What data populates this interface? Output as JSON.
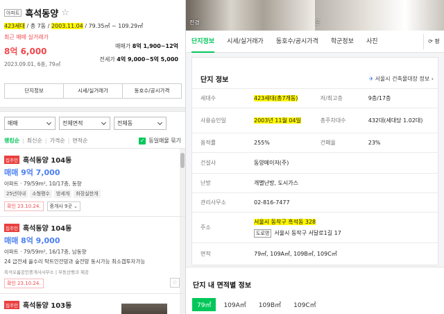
{
  "listing_header": {
    "badge": "아파트",
    "name": "흑석동양",
    "star": "☆",
    "units": "423세대",
    "floors": "총 7동",
    "built": "2003.11.04",
    "area": "79.35㎡ ~ 109.29㎡",
    "recent_label": "최근 매매 실거래가",
    "recent_price": "8억 6,000",
    "recent_date": "2023.09.01, 6층, 79㎡",
    "sale_label": "매매가",
    "sale_range": "8억 1,900~12억",
    "jeonse_label": "전세가",
    "jeonse_range": "4억 9,000~5억 5,000"
  },
  "action_buttons": [
    "단지정보",
    "시세/실거래가",
    "동호수/공시가격"
  ],
  "filters": [
    "매매",
    "전체면적",
    "전체동"
  ],
  "sort": {
    "options": [
      "랭킹순",
      "최신순",
      "가격순",
      "면적순"
    ],
    "same_listing": "동일매물 묶기"
  },
  "listings": [
    {
      "badge": "집주인",
      "name": "흑석동양 104동",
      "price": "매매 9억 7,000",
      "spec": "아파트 · 79/59m², 10/17층, 동향",
      "tags": [
        "25년이내",
        "소형평수",
        "방세개",
        "화장실한개"
      ],
      "confirm": "확인 23.10.24.",
      "brokers": "중개사 9곳 ⌄"
    },
    {
      "badge": "집주인",
      "name": "흑석동양 104동",
      "price": "매매 8억 9,000",
      "spec": "아파트 · 79/59m², 16/17층, 남동향",
      "context": "24 급전세 올수리 탁트인전망과 숲전망 동시가능 최소갭투자가능",
      "agent": "흑석오름공인중개사사무소 | 부동산뱅크 제공",
      "confirm": "확인 23.10.24."
    },
    {
      "badge": "집주인",
      "name": "흑석동양 103동"
    }
  ],
  "photos": [
    "전경",
    "경문"
  ],
  "tabs": [
    "단지정보",
    "시세/실거래가",
    "동호수/공시가격",
    "학군정보",
    "사진"
  ],
  "refresh": "⟳ 평",
  "complex_info": {
    "title": "단지 정보",
    "link": "서울시 건축물대장 정보 ›",
    "pin": "✈",
    "rows": [
      {
        "k1": "세대수",
        "v1": "423세대(총7개동)",
        "k2": "저/최고층",
        "v2": "9층/17층"
      },
      {
        "k1": "사용승인일",
        "v1": "2003년 11월 04일",
        "k2": "총주차대수",
        "v2": "432대(세대당 1.02대)"
      },
      {
        "k1": "용적률",
        "v1": "255%",
        "k2": "건폐율",
        "v2": "23%"
      },
      {
        "k1": "건설사",
        "v1": "동양메이저(주)"
      },
      {
        "k1": "난방",
        "v1": "개별난방, 도시가스"
      },
      {
        "k1": "관리사무소",
        "v1": "02-816-7477"
      },
      {
        "k1": "주소",
        "v1": "서울시 동작구 흑석동 328",
        "road_badge": "도로명",
        "road_addr": "서울시 동작구 서달로1길 17"
      },
      {
        "k1": "면적",
        "v1": "79㎡, 109A㎡, 109B㎡, 109C㎡"
      }
    ]
  },
  "area_section": {
    "title": "단지 내 면적별 정보",
    "tabs": [
      "79㎡",
      "109A㎡",
      "109B㎡",
      "109C㎡"
    ]
  },
  "colors": {
    "accent_green": "#03c75a",
    "price_red": "#f0484d",
    "price_blue": "#4a7ff2",
    "highlight": "#fff700"
  }
}
